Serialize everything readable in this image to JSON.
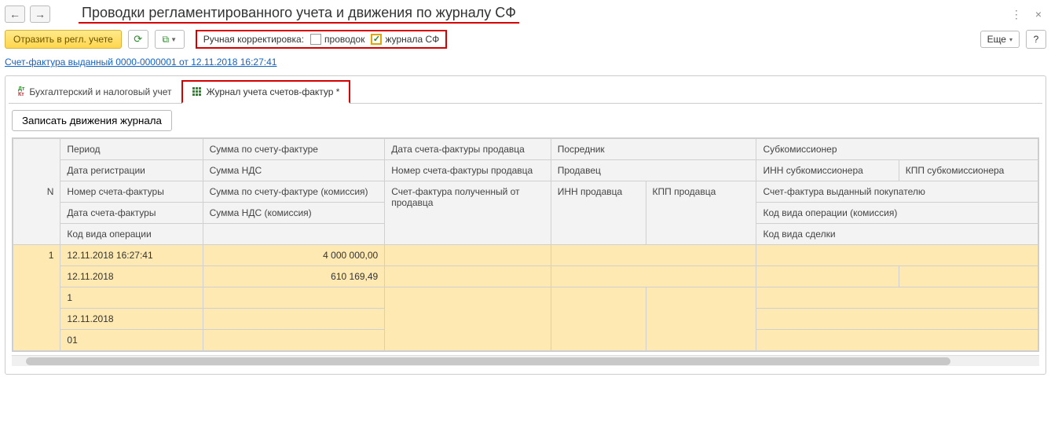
{
  "header": {
    "title": "Проводки регламентированного учета и движения по журналу СФ"
  },
  "toolbar": {
    "reflect_label": "Отразить в регл. учете",
    "manual_label": "Ручная корректировка:",
    "cb_provodok": "проводок",
    "cb_journal": "журнала СФ",
    "more_label": "Еще"
  },
  "link": {
    "text": "Счет-фактура выданный 0000-0000001 от 12.11.2018 16:27:41"
  },
  "tabs": {
    "accounting": "Бухгалтерский и налоговый учет",
    "journal": "Журнал учета счетов-фактур *"
  },
  "buttons": {
    "write": "Записать движения журнала"
  },
  "grid": {
    "headers": {
      "n": "N",
      "c1r1": "Период",
      "c1r2": "Дата регистрации",
      "c1r3": "Номер счета-фактуры",
      "c1r4": "Дата счета-фактуры",
      "c1r5": "Код вида операции",
      "c2r1": "Сумма по счету-фактуре",
      "c2r2": "Сумма НДС",
      "c2r3": "Сумма по счету-фактуре (комиссия)",
      "c2r4": "Сумма НДС (комиссия)",
      "c3r1": "Дата счета-фактуры продавца",
      "c3r2": "Номер счета-фактуры продавца",
      "c3r3": "Счет-фактура полученный от продавца",
      "c4r1": "Посредник",
      "c4r2": "Продавец",
      "c4r3": "ИНН продавца",
      "c4r4": "КПП продавца",
      "c5r1": "Субкомиссионер",
      "c5r2": "ИНН субкомиссионера",
      "c5r2b": "КПП субкомиссионера",
      "c5r3": "Счет-фактура выданный покупателю",
      "c5r4": "Код вида операции (комиссия)",
      "c5r5": "Код вида сделки"
    },
    "row": {
      "n": "1",
      "period": "12.11.2018 16:27:41",
      "reg_date": "12.11.2018",
      "sf_number": "1",
      "sf_date": "12.11.2018",
      "op_code": "01",
      "sum_sf": "4 000 000,00",
      "sum_nds": "610 169,49"
    }
  }
}
